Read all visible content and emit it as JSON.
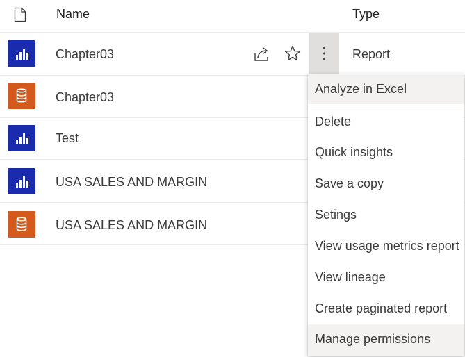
{
  "header": {
    "name_label": "Name",
    "type_label": "Type",
    "icon": "document-icon"
  },
  "rows": [
    {
      "name": "Chapter03",
      "type": "Report",
      "kind": "report",
      "icon": "report-icon"
    },
    {
      "name": "Chapter03",
      "type": "",
      "kind": "dataset",
      "icon": "dataset-icon"
    },
    {
      "name": "Test",
      "type": "",
      "kind": "report",
      "icon": "report-icon"
    },
    {
      "name": "USA SALES AND MARGIN",
      "type": "",
      "kind": "report",
      "icon": "report-icon"
    },
    {
      "name": "USA SALES AND MARGIN",
      "type": "",
      "kind": "dataset",
      "icon": "dataset-icon"
    }
  ],
  "row_actions": {
    "share_icon": "share-icon",
    "favorite_icon": "star-icon",
    "more_icon": "more-options-icon"
  },
  "context_menu": {
    "items": [
      "Analyze in Excel",
      "Delete",
      "Quick insights",
      "Save a copy",
      "Setings",
      "View usage metrics report",
      "View lineage",
      "Create paginated report",
      "Manage permissions"
    ]
  },
  "colors": {
    "report_badge": "#1b2bad",
    "dataset_badge": "#d35a1c",
    "hover": "#f3f2f1",
    "active_button": "#e1dfdd"
  }
}
